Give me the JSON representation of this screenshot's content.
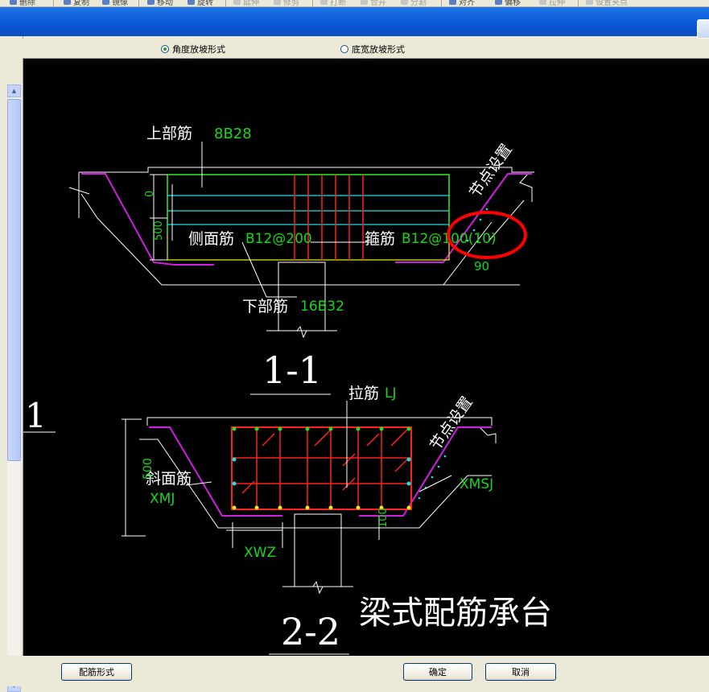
{
  "toolbar": {
    "buttons": [
      {
        "label": "删除",
        "enabled": true
      },
      {
        "label": "复制",
        "enabled": true
      },
      {
        "label": "镜像",
        "enabled": true
      },
      {
        "label": "移动",
        "enabled": true
      },
      {
        "label": "旋转",
        "enabled": true
      },
      {
        "label": "延伸",
        "enabled": false
      },
      {
        "label": "修剪",
        "enabled": false
      },
      {
        "label": "打断",
        "enabled": false
      },
      {
        "label": "合并",
        "enabled": false
      },
      {
        "label": "分割",
        "enabled": false
      },
      {
        "label": "对齐",
        "enabled": true
      },
      {
        "label": "偏移",
        "enabled": true
      },
      {
        "label": "拉伸",
        "enabled": false
      },
      {
        "label": "设置夹点",
        "enabled": false
      }
    ]
  },
  "options": {
    "angle_slope": "角度放坡形式",
    "width_slope": "底宽放坡形式",
    "selected": "angle_slope"
  },
  "drawing": {
    "section_marker": "1",
    "section1": {
      "label": "1-1",
      "top_rebar_label": "上部筋",
      "top_rebar_value": "8B28",
      "side_rebar_label": "侧面筋",
      "side_rebar_value": "B12@200",
      "stirrup_label": "箍筋",
      "stirrup_value": "B12@100(10)",
      "bottom_rebar_label": "下部筋",
      "bottom_rebar_value": "16B32",
      "node_setting": "节点设置",
      "dim_0": "0",
      "dim_500": "500",
      "angle_90": "90"
    },
    "section2": {
      "label": "2-2",
      "tie_bar_label": "拉筋",
      "tie_bar_value": "LJ",
      "slope_rebar_label": "斜面筋",
      "slope_rebar_value": "XMJ",
      "node_setting": "节点设置",
      "xmsj": "XMSJ",
      "xwz": "XWZ",
      "dim_500": "500",
      "dim_100": "100"
    },
    "title": "梁式配筋承台",
    "colors": {
      "background": "#000000",
      "rebar_red": "#ff2020",
      "rebar_green": "#20e020",
      "rebar_cyan": "#20e0e0",
      "rebar_yellow": "#f0f020",
      "formwork_magenta": "#d01ee0",
      "highlight_circle": "#ff0000"
    }
  },
  "buttons": {
    "rebar_form": "配筋形式",
    "ok": "确定",
    "cancel": "取消"
  }
}
